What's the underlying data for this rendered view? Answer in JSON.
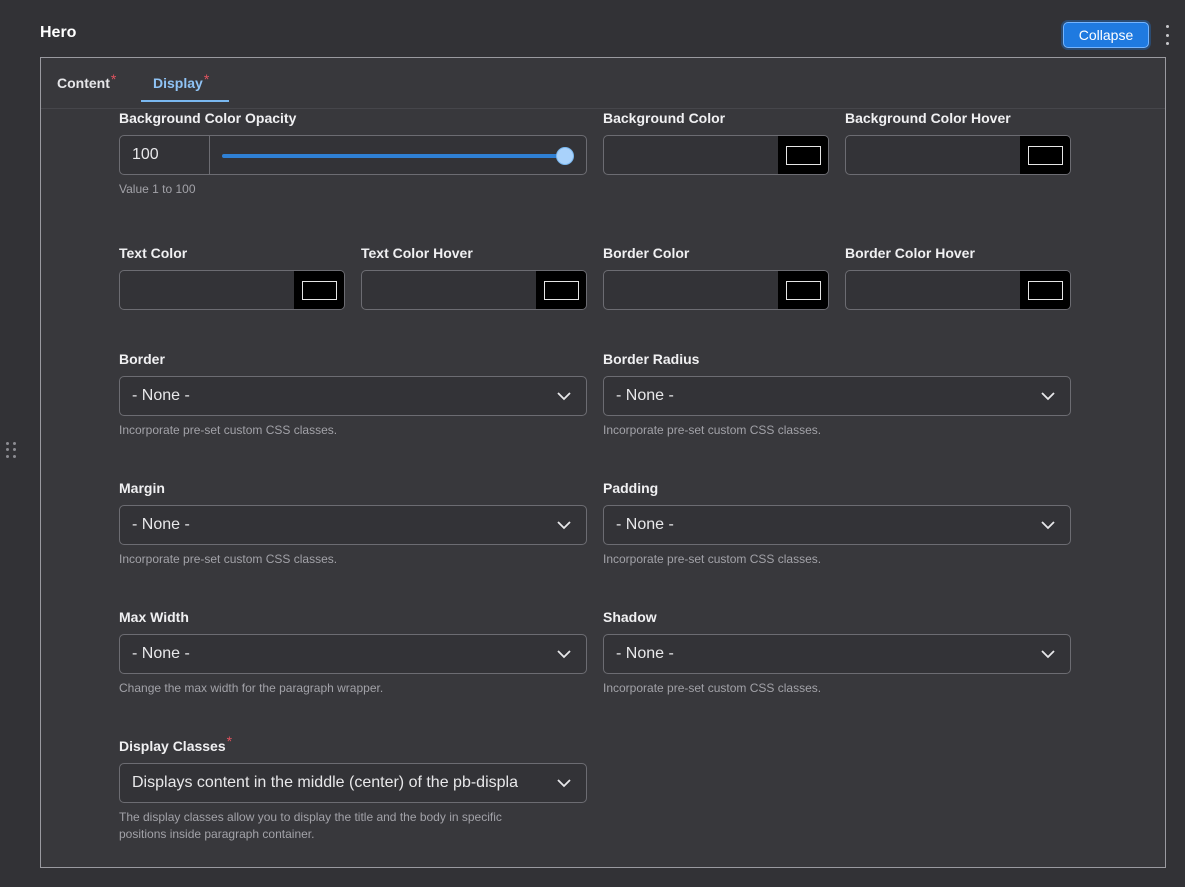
{
  "header": {
    "title": "Hero",
    "collapse_label": "Collapse"
  },
  "tabs": [
    {
      "label": "Content",
      "required": "*"
    },
    {
      "label": "Display",
      "required": "*"
    }
  ],
  "fields": {
    "bg_opacity": {
      "label": "Background Color Opacity",
      "value": "100",
      "slider_fraction": 1.0,
      "help": "Value 1 to 100"
    },
    "bg_color": {
      "label": "Background Color",
      "swatch": "#000000"
    },
    "bg_color_hover": {
      "label": "Background Color Hover",
      "swatch": "#000000"
    },
    "text_color": {
      "label": "Text Color",
      "swatch": "#000000"
    },
    "text_color_hover": {
      "label": "Text Color Hover",
      "swatch": "#000000"
    },
    "border_color": {
      "label": "Border Color",
      "swatch": "#000000"
    },
    "border_color_hover": {
      "label": "Border Color Hover",
      "swatch": "#000000"
    },
    "border": {
      "label": "Border",
      "value": "- None -",
      "help": "Incorporate pre-set custom CSS classes."
    },
    "border_radius": {
      "label": "Border Radius",
      "value": "- None -",
      "help": "Incorporate pre-set custom CSS classes."
    },
    "margin": {
      "label": "Margin",
      "value": "- None -",
      "help": "Incorporate pre-set custom CSS classes."
    },
    "padding": {
      "label": "Padding",
      "value": "- None -",
      "help": "Incorporate pre-set custom CSS classes."
    },
    "max_width": {
      "label": "Max Width",
      "value": "- None -",
      "help": "Change the max width for the paragraph wrapper."
    },
    "shadow": {
      "label": "Shadow",
      "value": "- None -",
      "help": "Incorporate pre-set custom CSS classes."
    },
    "display_classes": {
      "label": "Display Classes",
      "required": "*",
      "value": "Displays content in the middle (center) of the pb-displa",
      "help_line1": "The display classes allow you to display the title and the body in specific",
      "help_line2": "positions inside paragraph container."
    }
  },
  "colors": {
    "accent": "#1f7ae0",
    "required": "#e0535f",
    "active_tab": "#8fc3f5"
  },
  "icons": [
    "kebab-menu-icon",
    "drag-handle-icon",
    "chevron-down-icon"
  ]
}
